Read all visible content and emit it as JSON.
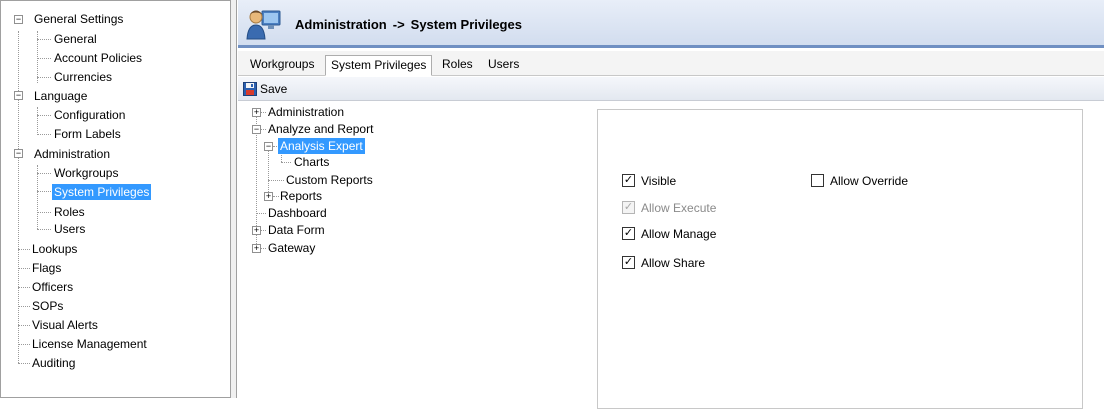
{
  "nav_tree": {
    "items": [
      {
        "label": "General Settings",
        "expander": "⊟"
      },
      {
        "label": "General"
      },
      {
        "label": "Account Policies"
      },
      {
        "label": "Currencies"
      },
      {
        "label": "Language",
        "expander": "⊟"
      },
      {
        "label": "Configuration"
      },
      {
        "label": "Form Labels"
      },
      {
        "label": "Administration",
        "expander": "⊟"
      },
      {
        "label": "Workgroups"
      },
      {
        "label": "System Privileges",
        "selected": true
      },
      {
        "label": "Roles"
      },
      {
        "label": "Users"
      },
      {
        "label": "Lookups"
      },
      {
        "label": "Flags"
      },
      {
        "label": "Officers"
      },
      {
        "label": "SOPs"
      },
      {
        "label": "Visual Alerts"
      },
      {
        "label": "License Management"
      },
      {
        "label": "Auditing"
      }
    ]
  },
  "header": {
    "icon": "admin-users-icon",
    "title_section": "Administration",
    "title_separator": "->",
    "title_page": "System Privileges"
  },
  "tabs": [
    {
      "label": "Workgroups"
    },
    {
      "label": "System Privileges",
      "active": true
    },
    {
      "label": "Roles"
    },
    {
      "label": "Users"
    }
  ],
  "toolbar": {
    "save_label": "Save",
    "save_icon": "floppy-disk-icon"
  },
  "privilege_tree": {
    "items": [
      {
        "label": "Administration",
        "expander": "+"
      },
      {
        "label": "Analyze and Report",
        "expander": "−"
      },
      {
        "label": "Analysis Expert",
        "expander": "−",
        "selected": true
      },
      {
        "label": "Charts"
      },
      {
        "label": "Custom Reports"
      },
      {
        "label": "Reports",
        "expander": "+"
      },
      {
        "label": "Dashboard"
      },
      {
        "label": "Data Form",
        "expander": "+"
      },
      {
        "label": "Gateway",
        "expander": "+"
      }
    ]
  },
  "privileges": {
    "visible": {
      "label": "Visible",
      "checked": true,
      "enabled": true
    },
    "allow_override": {
      "label": "Allow Override",
      "checked": false,
      "enabled": true
    },
    "allow_execute": {
      "label": "Allow Execute",
      "checked": true,
      "enabled": false
    },
    "allow_manage": {
      "label": "Allow Manage",
      "checked": true,
      "enabled": true
    },
    "allow_share": {
      "label": "Allow Share",
      "checked": true,
      "enabled": true
    }
  },
  "colors": {
    "selection": "#3399ff",
    "header_border": "#6f8fc2"
  }
}
